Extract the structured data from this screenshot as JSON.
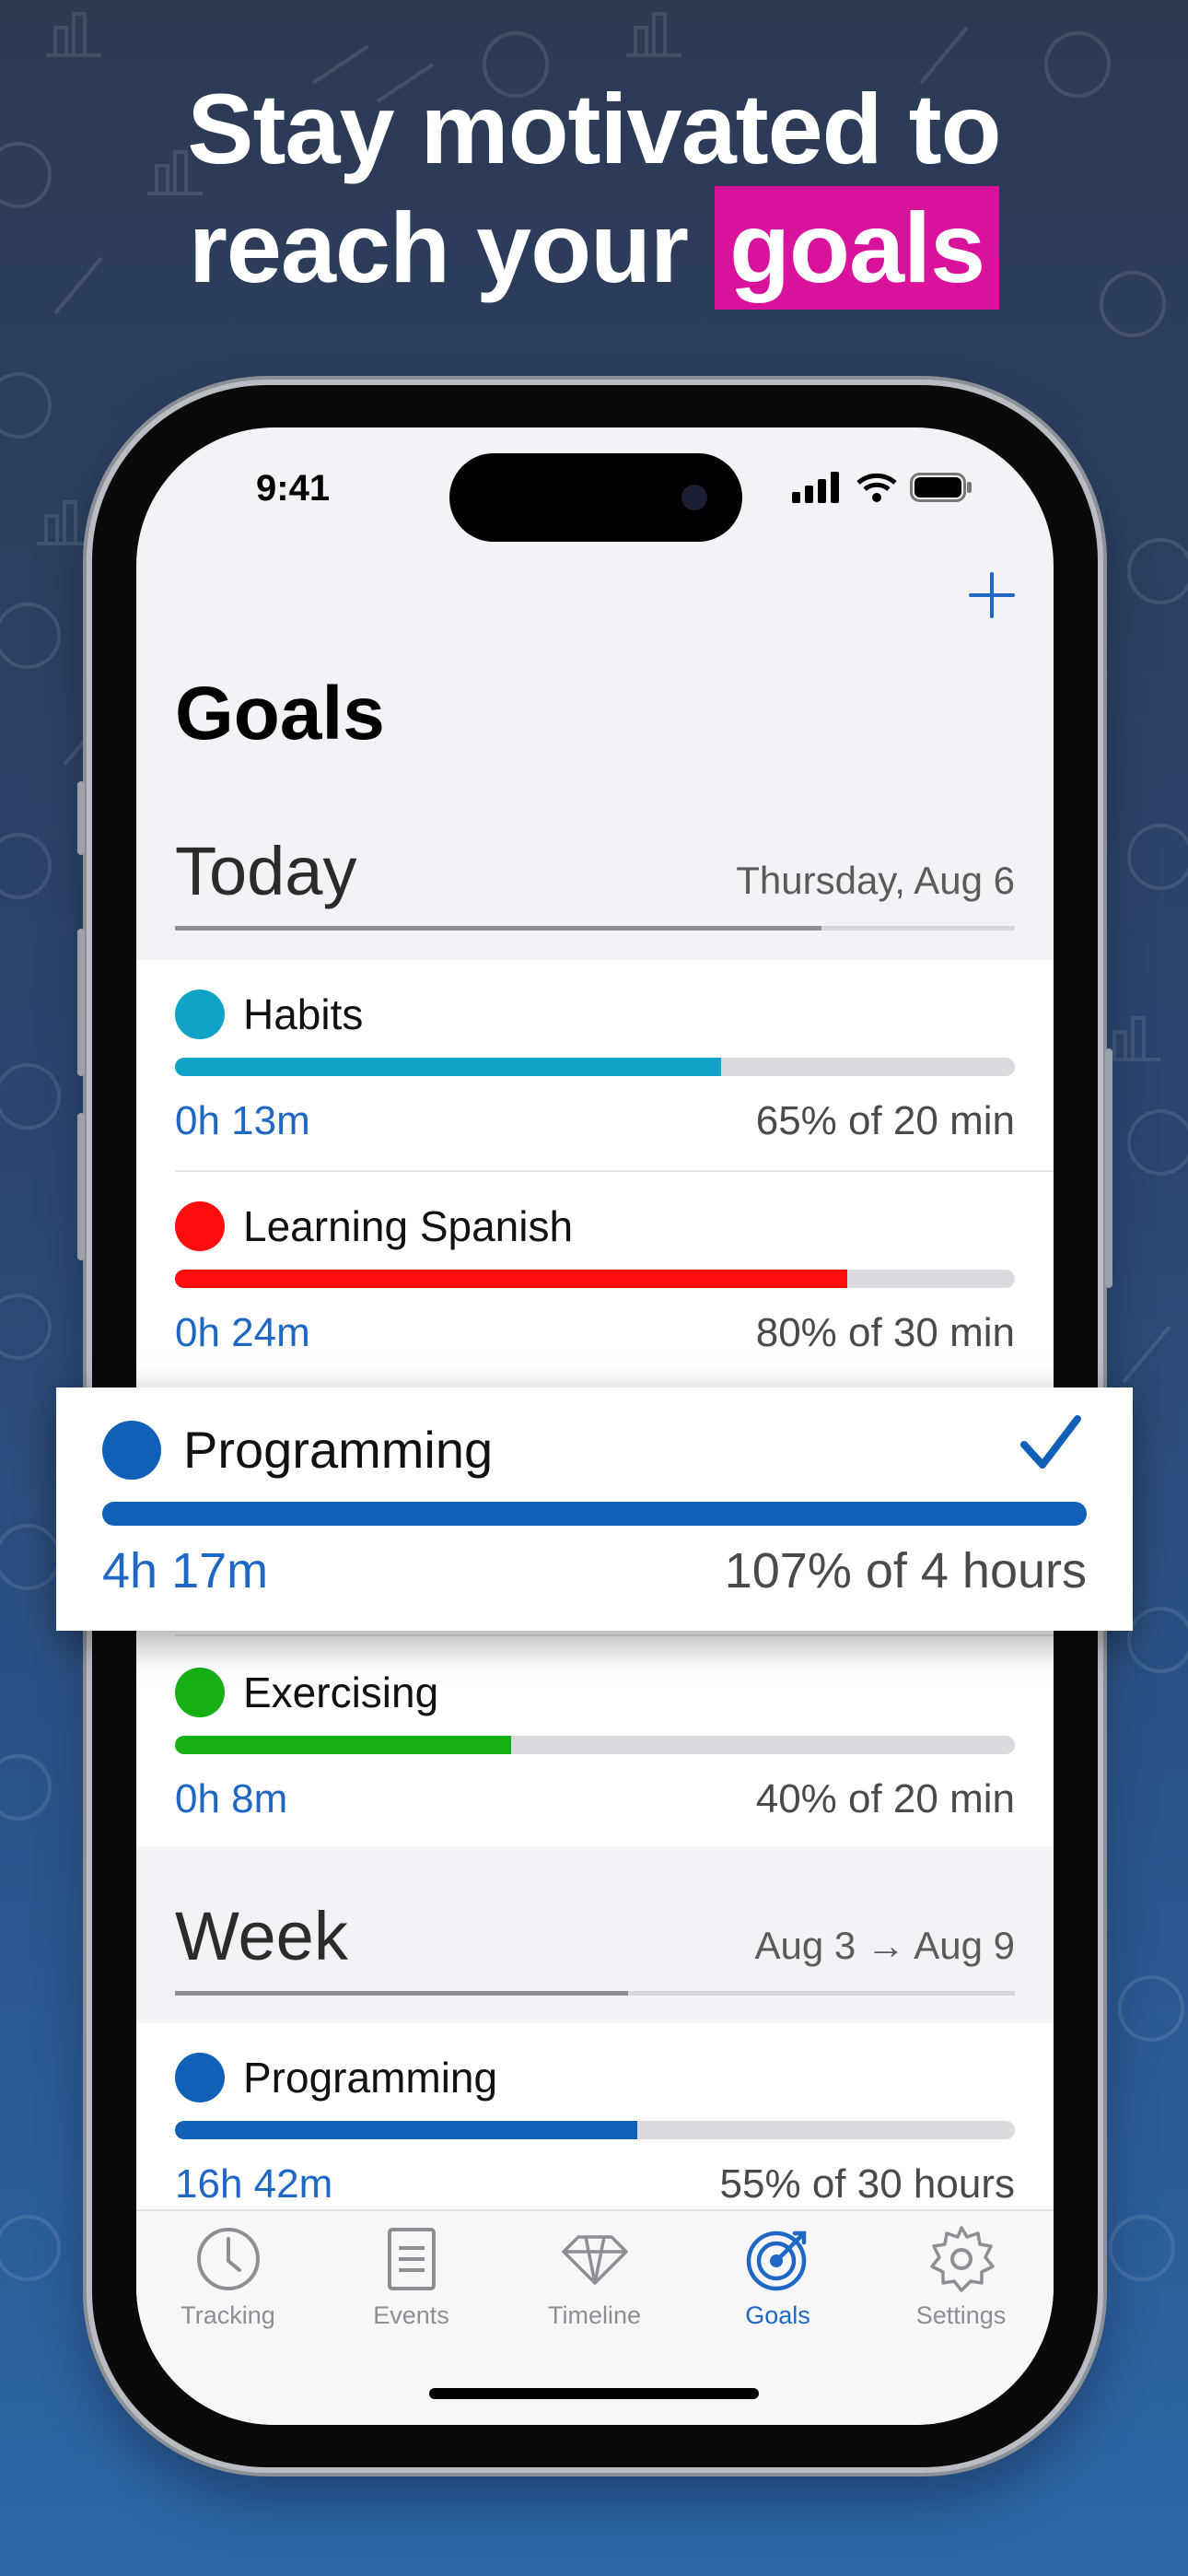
{
  "marketing": {
    "headline_line1": "Stay motivated to",
    "headline_line2_prefix": "reach your",
    "headline_highlight": "goals",
    "highlight_color": "#d8129a"
  },
  "status_bar": {
    "time": "9:41"
  },
  "nav": {
    "add_icon": "plus-icon"
  },
  "page": {
    "title": "Goals"
  },
  "today": {
    "label": "Today",
    "date": "Thursday, Aug 6",
    "overall_progress": 0.77,
    "goals": [
      {
        "name": "Habits",
        "color": "#0fa3c7",
        "progress": 0.65,
        "time": "0h 13m",
        "summary": "65% of 20 min"
      },
      {
        "name": "Learning Spanish",
        "color": "#ff0d0d",
        "progress": 0.8,
        "time": "0h 24m",
        "summary": "80% of 30 min"
      },
      {
        "name": "Programming",
        "color": "#1160b8",
        "progress": 1.0,
        "time": "4h 17m",
        "summary": "107% of 4 hours",
        "completed": true
      },
      {
        "name": "Exercising",
        "color": "#16b016",
        "progress": 0.4,
        "time": "0h 8m",
        "summary": "40% of 20 min"
      }
    ]
  },
  "week": {
    "label": "Week",
    "date": "Aug 3 → Aug 9",
    "overall_progress": 0.54,
    "goals": [
      {
        "name": "Programming",
        "color": "#1160b8",
        "progress": 0.55,
        "time": "16h 42m",
        "summary": "55% of 30 hours"
      }
    ]
  },
  "tabs": [
    {
      "label": "Tracking",
      "icon": "clock-icon",
      "active": false
    },
    {
      "label": "Events",
      "icon": "document-icon",
      "active": false
    },
    {
      "label": "Timeline",
      "icon": "timeline-icon",
      "active": false
    },
    {
      "label": "Goals",
      "icon": "target-icon",
      "active": true
    },
    {
      "label": "Settings",
      "icon": "gear-icon",
      "active": false
    }
  ],
  "colors": {
    "accent": "#1f67c4"
  }
}
